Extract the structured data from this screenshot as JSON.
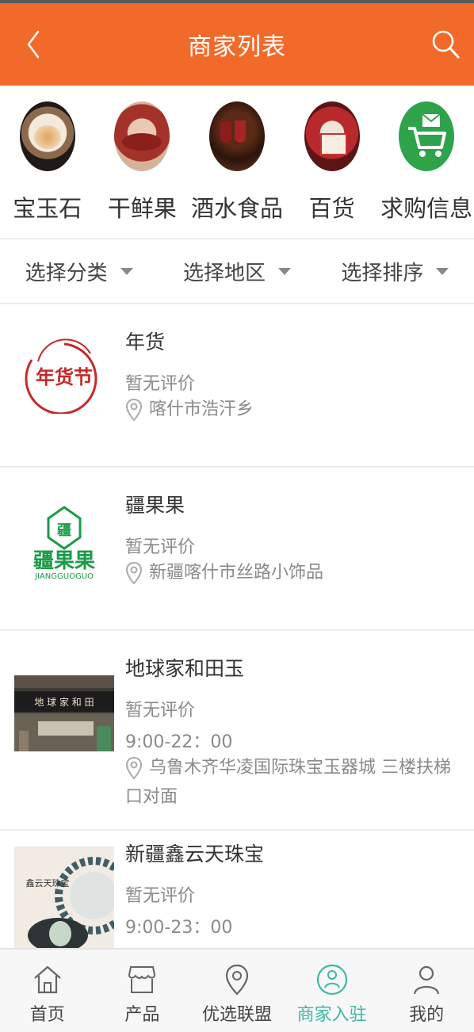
{
  "header": {
    "title": "商家列表"
  },
  "categories": [
    {
      "label": "宝玉石"
    },
    {
      "label": "干鲜果"
    },
    {
      "label": "酒水食品"
    },
    {
      "label": "百货"
    },
    {
      "label": "求购信息"
    }
  ],
  "filters": [
    {
      "label": "选择分类"
    },
    {
      "label": "选择地区"
    },
    {
      "label": "选择排序"
    }
  ],
  "merchants": [
    {
      "name": "年货",
      "rating": "暂无评价",
      "address": "喀什市浩汗乡",
      "logo_text": "年货节"
    },
    {
      "name": "疆果果",
      "rating": "暂无评价",
      "address": "新疆喀什市丝路小饰品",
      "logo_text": "疆果果",
      "logo_sub": "JIANGGUOGUO",
      "logo_badge": "疆"
    },
    {
      "name": "地球家和田玉",
      "rating": "暂无评价",
      "hours": "9:00-22：00",
      "address": "乌鲁木齐华凌国际珠宝玉器城 三楼扶梯口对面",
      "logo_text": "地 球 家 和 田"
    },
    {
      "name": "新疆鑫云天珠宝",
      "rating": "暂无评价",
      "hours": "9:00-23：00",
      "logo_text": "鑫云天珠宝"
    }
  ],
  "tabs": [
    {
      "label": "首页",
      "icon": "home-icon"
    },
    {
      "label": "产品",
      "icon": "shop-icon"
    },
    {
      "label": "优选联盟",
      "icon": "location-pin-icon"
    },
    {
      "label": "商家入驻",
      "icon": "merchant-join-icon",
      "active": true
    },
    {
      "label": "我的",
      "icon": "user-icon"
    }
  ],
  "colors": {
    "header": "#f26a2a",
    "active_tab": "#3cb8a3",
    "brand_green": "#1a9b48",
    "festive_red": "#c62828"
  }
}
